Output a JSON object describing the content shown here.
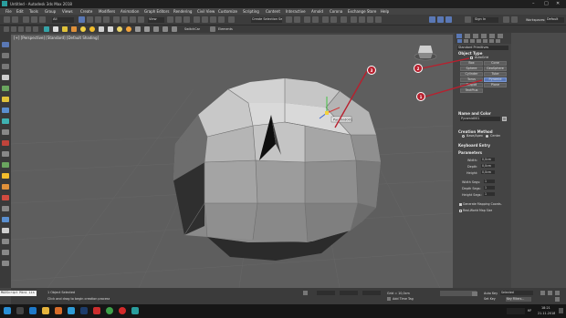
{
  "title": "Untitled - Autodesk 3ds Max 2018",
  "menu": [
    "File",
    "Edit",
    "Tools",
    "Group",
    "Views",
    "Create",
    "Modifiers",
    "Animation",
    "Graph Editors",
    "Rendering",
    "Civil View",
    "Customize",
    "Scripting",
    "Content",
    "Interactive",
    "Arnold",
    "Corona",
    "Exchange Store",
    "Help"
  ],
  "sign_in": "Sign In",
  "workspaces_label": "Workspaces:",
  "workspace_value": "Default",
  "toolbar": {
    "filter_value": "All",
    "view_value": "View",
    "selection_set": "Create Selection Se",
    "switch_car": "SwitchCar",
    "elements": "Elements"
  },
  "viewport": {
    "label": "[+] [Perspective] [Standard] [Default Shading]",
    "gizmo_tooltip": "Pyramid001"
  },
  "command_panel": {
    "category": "Standard Primitives",
    "object_type_title": "Object Type",
    "autogrid": "AutoGrid",
    "primitives": [
      "Box",
      "Cone",
      "Sphere",
      "GeoSphere",
      "Cylinder",
      "Tube",
      "Torus",
      "Pyramid",
      "Teapot",
      "Plane",
      "TextPlus"
    ],
    "active_primitive": "Pyramid",
    "name_color_title": "Name and Color",
    "object_name": "Pyramid001",
    "creation_method_title": "Creation Method",
    "creation_options": [
      "Base/Apex",
      "Center"
    ],
    "keyboard_entry_title": "Keyboard Entry",
    "parameters_title": "Parameters",
    "params": [
      {
        "label": "Width:",
        "value": "0,0cm"
      },
      {
        "label": "Depth:",
        "value": "0,0cm"
      },
      {
        "label": "Height:",
        "value": "0,0cm"
      },
      {
        "label": "Width Segs:",
        "value": "1"
      },
      {
        "label": "Depth Segs:",
        "value": "1"
      },
      {
        "label": "Height Segs:",
        "value": "1"
      }
    ],
    "gen_mapping": "Generate Mapping Coords.",
    "real_world": "Real-World Map Size"
  },
  "callouts": [
    "1",
    "2",
    "3"
  ],
  "status": {
    "maxscript": "MAXScript Mini Lis",
    "selected": "1 Object Selected",
    "prompt": "Click and drag to begin creation process",
    "grid": "Grid = 10,0cm",
    "add_time_tag": "Add Time Tag",
    "auto_key": "Auto Key",
    "key_selected": "Selected",
    "set_key": "Set Key",
    "key_filters": "Key Filters..."
  },
  "taskbar": {
    "lang": "КР",
    "time": "18:21",
    "date": "21.11.2018"
  },
  "colors": {
    "accent": "#5a78b5",
    "callout": "#b8202e",
    "viewport_bg": "#5e5e5e"
  }
}
